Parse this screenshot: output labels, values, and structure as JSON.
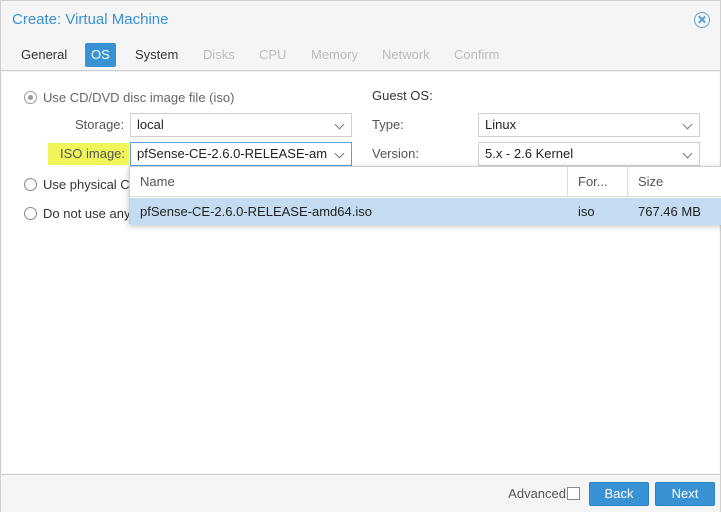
{
  "window": {
    "title": "Create: Virtual Machine"
  },
  "tabs": [
    {
      "label": "General",
      "state": "normal"
    },
    {
      "label": "OS",
      "state": "active"
    },
    {
      "label": "System",
      "state": "normal"
    },
    {
      "label": "Disks",
      "state": "disabled"
    },
    {
      "label": "CPU",
      "state": "disabled"
    },
    {
      "label": "Memory",
      "state": "disabled"
    },
    {
      "label": "Network",
      "state": "disabled"
    },
    {
      "label": "Confirm",
      "state": "disabled"
    }
  ],
  "media": {
    "use_iso_label": "Use CD/DVD disc image file (iso)",
    "use_physical_label": "Use physical C",
    "no_media_label": "Do not use any",
    "storage_label": "Storage:",
    "storage_value": "local",
    "iso_label": "ISO image:",
    "iso_value": "pfSense-CE-2.6.0-RELEASE-am"
  },
  "guest_os": {
    "heading": "Guest OS:",
    "type_label": "Type:",
    "type_value": "Linux",
    "version_label": "Version:",
    "version_value": "5.x - 2.6 Kernel"
  },
  "iso_dropdown": {
    "columns": [
      "Name",
      "For...",
      "Size"
    ],
    "rows": [
      {
        "name": "pfSense-CE-2.6.0-RELEASE-amd64.iso",
        "format": "iso",
        "size": "767.46 MB"
      }
    ]
  },
  "footer": {
    "advanced_label": "Advanced",
    "back_label": "Back",
    "next_label": "Next"
  },
  "colors": {
    "accent": "#3892d4",
    "highlight": "#f0f55a",
    "selected_row": "#c3dcf1"
  }
}
